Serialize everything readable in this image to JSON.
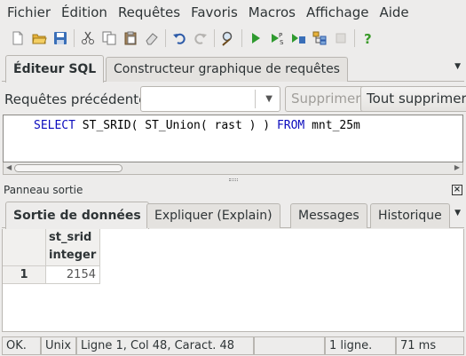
{
  "menubar": {
    "items": [
      "Fichier",
      "Édition",
      "Requêtes",
      "Favoris",
      "Macros",
      "Affichage",
      "Aide"
    ]
  },
  "toolbar": {
    "icons": [
      "new-file-icon",
      "open-folder-icon",
      "save-icon",
      "cut-icon",
      "copy-icon",
      "paste-icon",
      "clear-icon",
      "undo-icon",
      "redo-icon",
      "find-icon",
      "execute-icon",
      "execute-pgscript-icon",
      "execute-to-file-icon",
      "explain-icon",
      "stop-icon",
      "help-icon"
    ]
  },
  "editor_tabs": {
    "sql_editor": "Éditeur SQL",
    "graphical_builder": "Constructeur graphique de requêtes"
  },
  "previous_queries": {
    "label": "Requêtes précédentes",
    "value": "",
    "delete_label": "Supprimer",
    "delete_all_label": "Tout supprimer"
  },
  "editor": {
    "kw_select": "SELECT",
    "text_1": " ST_SRID( ST_Union( rast ) ) ",
    "kw_from": "FROM",
    "text_2": " mnt_25m"
  },
  "output_panel": {
    "title": "Panneau sortie",
    "tabs": [
      "Sortie de données",
      "Expliquer (Explain)",
      "Messages",
      "Historique"
    ]
  },
  "result_grid": {
    "column_name": "st_srid",
    "column_type": "integer",
    "rows": [
      {
        "num": "1",
        "value": "2154"
      }
    ]
  },
  "statusbar": {
    "state": "OK.",
    "line_ending": "Unix",
    "position": "Ligne 1, Col 48, Caract. 48",
    "rows": "1 ligne.",
    "time": "71 ms"
  }
}
